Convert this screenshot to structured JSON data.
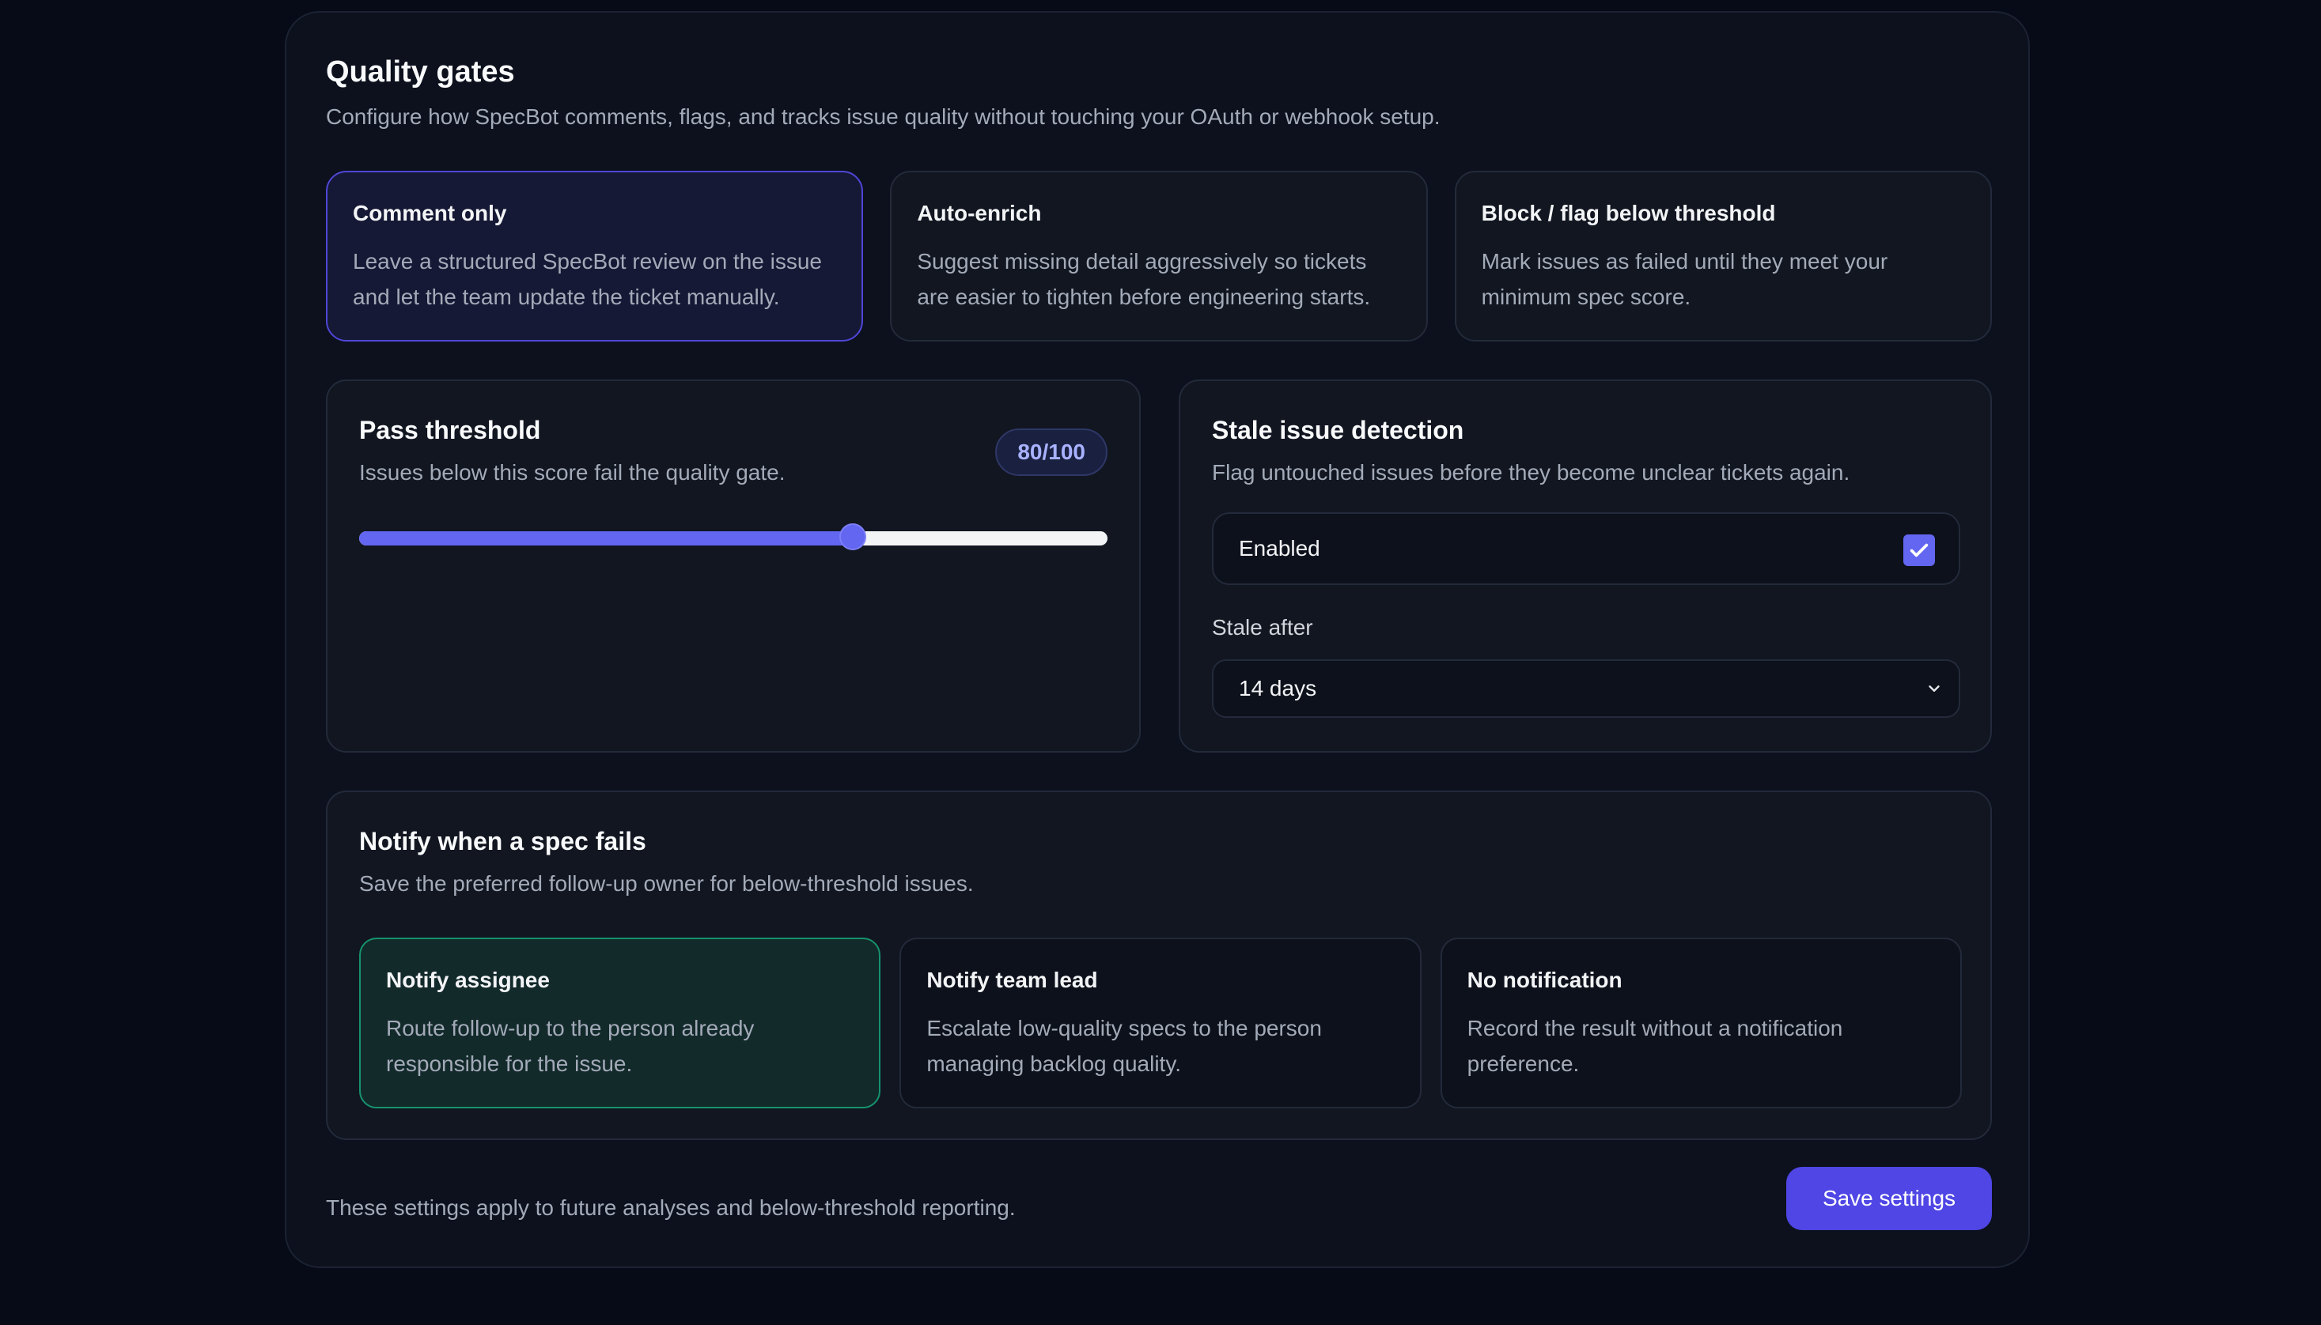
{
  "header": {
    "title": "Quality gates",
    "subtitle": "Configure how SpecBot comments, flags, and tracks issue quality without touching your OAuth or webhook setup."
  },
  "modes": [
    {
      "title": "Comment only",
      "desc": "Leave a structured SpecBot review on the issue and let the team update the ticket manually.",
      "selected": true
    },
    {
      "title": "Auto-enrich",
      "desc": "Suggest missing detail aggressively so tickets are easier to tighten before engineering starts.",
      "selected": false
    },
    {
      "title": "Block / flag below threshold",
      "desc": "Mark issues as failed until they meet your minimum spec score.",
      "selected": false
    }
  ],
  "threshold": {
    "title": "Pass threshold",
    "subtitle": "Issues below this score fail the quality gate.",
    "value": 80,
    "max": 100,
    "badge": "80/100",
    "accent": "#6366f1"
  },
  "stale": {
    "title": "Stale issue detection",
    "subtitle": "Flag untouched issues before they become unclear tickets again.",
    "toggle_label": "Enabled",
    "enabled": true,
    "field_label": "Stale after",
    "select_value": "14 days"
  },
  "notify": {
    "title": "Notify when a spec fails",
    "subtitle": "Save the preferred follow-up owner for below-threshold issues.",
    "options": [
      {
        "title": "Notify assignee",
        "desc": "Route follow-up to the person already responsible for the issue.",
        "selected": true
      },
      {
        "title": "Notify team lead",
        "desc": "Escalate low-quality specs to the person managing backlog quality.",
        "selected": false
      },
      {
        "title": "No notification",
        "desc": "Record the result without a notification preference.",
        "selected": false
      }
    ]
  },
  "footer": {
    "note": "These settings apply to future analyses and below-threshold reporting.",
    "save_label": "Save settings"
  },
  "colors": {
    "background": "#070b17",
    "panel": "#0c111d",
    "primary": "#4f46e5",
    "selected_notify": "#15936d"
  }
}
